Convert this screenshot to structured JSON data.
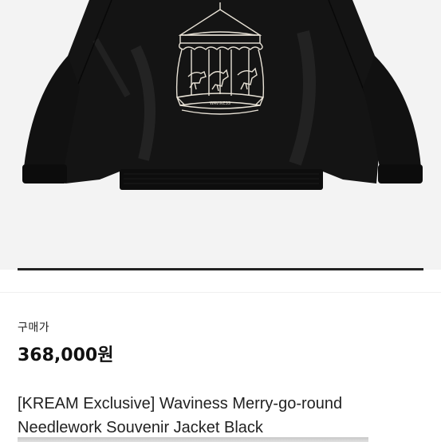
{
  "product": {
    "price_label": "구매가",
    "price": "368,000원",
    "name_line1": "[KREAM Exclusive] Waviness Merry-go-round",
    "name_line2": "Needlework Souvenir Jacket Black",
    "image_gallery_progress": 1.0,
    "embroidery_text": "WAVINESS"
  },
  "colors": {
    "background": "#ffffff",
    "photo_background": "#f3f3f3",
    "jacket": "#141414",
    "embroidery": "#e8e2d6",
    "progress": "#222222"
  }
}
